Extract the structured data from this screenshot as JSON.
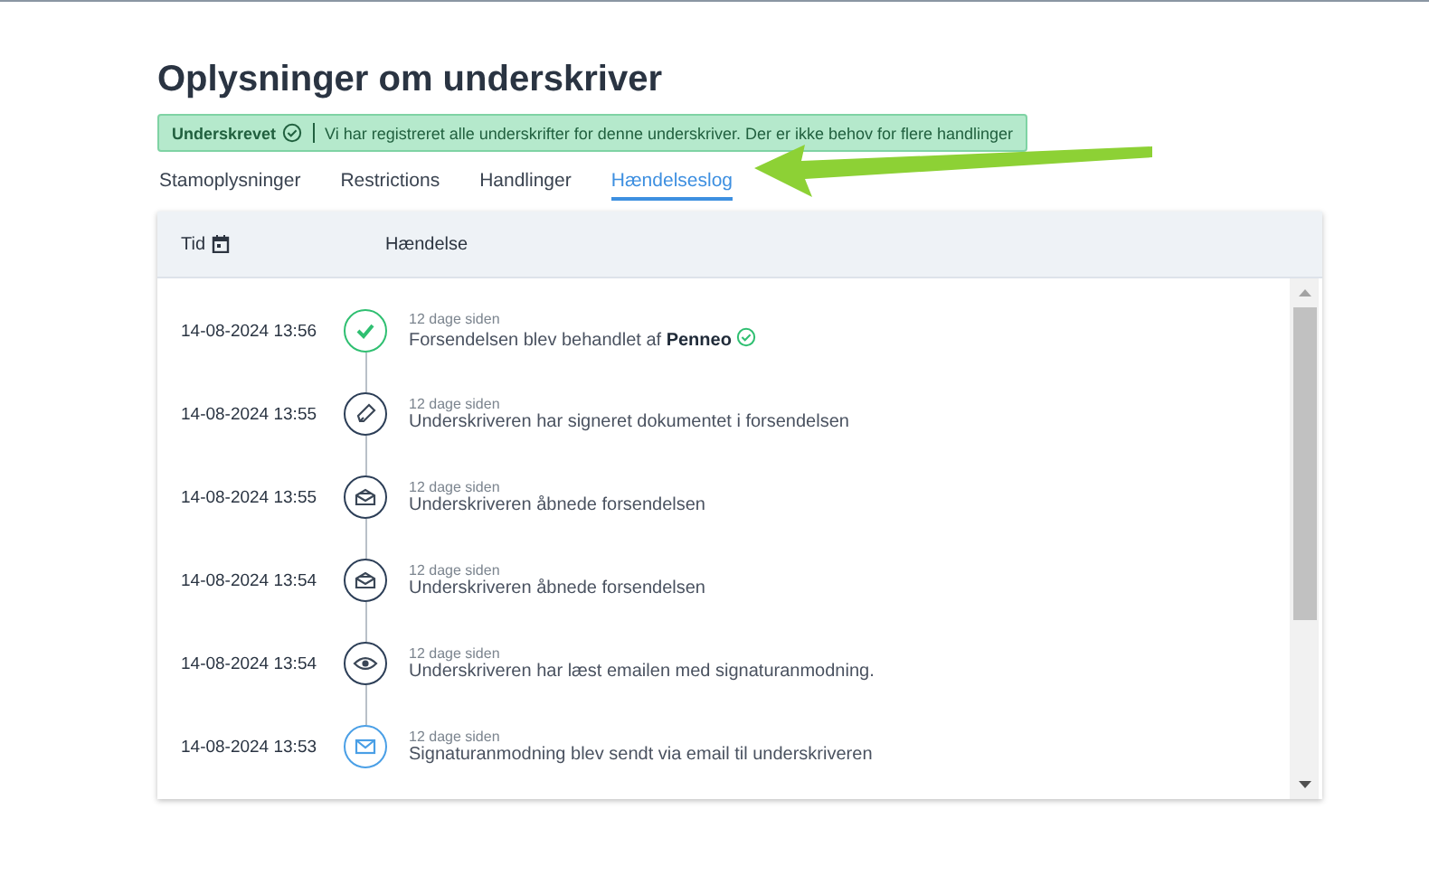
{
  "title": "Oplysninger om underskriver",
  "banner": {
    "status": "Underskrevet",
    "message": "Vi har registreret alle underskrifter for denne underskriver. Der er ikke behov for flere handlinger"
  },
  "tabs": [
    {
      "label": "Stamoplysninger",
      "selected": false
    },
    {
      "label": "Restrictions",
      "selected": false
    },
    {
      "label": "Handlinger",
      "selected": false
    },
    {
      "label": "Hændelseslog",
      "selected": true
    }
  ],
  "table": {
    "columns": [
      "Tid",
      "Hændelse"
    ],
    "rows": [
      {
        "time": "14-08-2024 13:56",
        "kind": "check",
        "ago": "12 dage siden",
        "event": "Forsendelsen blev behandlet af **Penneo**",
        "verified": true
      },
      {
        "time": "14-08-2024 13:55",
        "kind": "pen",
        "ago": "12 dage siden",
        "event": "Underskriveren har signeret dokumentet i forsendelsen",
        "verified": false
      },
      {
        "time": "14-08-2024 13:55",
        "kind": "opened",
        "ago": "12 dage siden",
        "event": "Underskriveren åbnede forsendelsen",
        "verified": false
      },
      {
        "time": "14-08-2024 13:54",
        "kind": "opened",
        "ago": "12 dage siden",
        "event": "Underskriveren åbnede forsendelsen",
        "verified": false
      },
      {
        "time": "14-08-2024 13:54",
        "kind": "eye",
        "ago": "12 dage siden",
        "event": "Underskriveren har læst emailen med signaturanmodning.",
        "verified": false
      },
      {
        "time": "14-08-2024 13:53",
        "kind": "mail",
        "ago": "12 dage siden",
        "event": "Signaturanmodning blev sendt via email til underskriveren",
        "verified": false
      }
    ]
  }
}
